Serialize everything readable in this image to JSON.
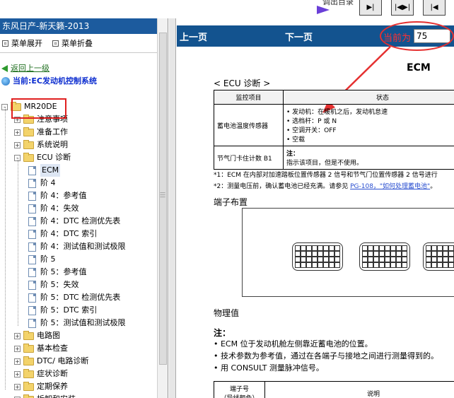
{
  "left_panel": {
    "title": "东风日产-新天籁-2013",
    "expand_label": "菜单展开",
    "collapse_label": "菜单折叠",
    "back_link": "返回上一级",
    "current_link": "当前:EC发动机控制系统"
  },
  "tree": [
    {
      "label": "MR20DE",
      "kind": "folder",
      "level": 0,
      "toggle": "-"
    },
    {
      "label": "注意事项",
      "kind": "folder",
      "level": 1,
      "toggle": "+"
    },
    {
      "label": "准备工作",
      "kind": "folder",
      "level": 1,
      "toggle": "+"
    },
    {
      "label": "系统说明",
      "kind": "folder",
      "level": 1,
      "toggle": "+"
    },
    {
      "label": "ECU 诊断",
      "kind": "folder",
      "level": 1,
      "toggle": "-"
    },
    {
      "label": "ECM",
      "kind": "doc",
      "level": 2,
      "selected": true
    },
    {
      "label": "阶 4",
      "kind": "doc",
      "level": 2
    },
    {
      "label": "阶 4：参考值",
      "kind": "doc",
      "level": 2
    },
    {
      "label": "阶 4：失效",
      "kind": "doc",
      "level": 2
    },
    {
      "label": "阶 4：DTC 检测优先表",
      "kind": "doc",
      "level": 2
    },
    {
      "label": "阶 4：DTC 索引",
      "kind": "doc",
      "level": 2
    },
    {
      "label": "阶 4：测试值和测试极限",
      "kind": "doc",
      "level": 2
    },
    {
      "label": "阶 5",
      "kind": "doc",
      "level": 2
    },
    {
      "label": "阶 5：参考值",
      "kind": "doc",
      "level": 2
    },
    {
      "label": "阶 5：失效",
      "kind": "doc",
      "level": 2
    },
    {
      "label": "阶 5：DTC 检测优先表",
      "kind": "doc",
      "level": 2
    },
    {
      "label": "阶 5：DTC 索引",
      "kind": "doc",
      "level": 2
    },
    {
      "label": "阶 5：测试值和测试极限",
      "kind": "doc",
      "level": 2
    },
    {
      "label": "电路图",
      "kind": "folder",
      "level": 1,
      "toggle": "+"
    },
    {
      "label": "基本检查",
      "kind": "folder",
      "level": 1,
      "toggle": "+"
    },
    {
      "label": "DTC/ 电路诊断",
      "kind": "folder",
      "level": 1,
      "toggle": "+"
    },
    {
      "label": "症状诊断",
      "kind": "folder",
      "level": 1,
      "toggle": "+"
    },
    {
      "label": "定期保养",
      "kind": "folder",
      "level": 1,
      "toggle": "+"
    },
    {
      "label": "拆卸和安装",
      "kind": "folder",
      "level": 1,
      "toggle": "+"
    }
  ],
  "toolbar": {
    "caption": "调出目录",
    "buttons": [
      "▶|",
      "|◀▶|",
      "|◀"
    ]
  },
  "nav": {
    "prev": "上一页",
    "next": "下一页",
    "current_label": "当前为",
    "page_value": "75"
  },
  "doc": {
    "title": "ECM",
    "section_diag": "< ECU 诊断 >",
    "table_header": [
      "监控项目",
      "状态"
    ],
    "table_rows": [
      {
        "item": "蓄电池温度传感器",
        "status": [
          "• 发动机：在暖机之后，发动机怠速",
          "• 选档杆：P 或 N",
          "• 空调开关：OFF",
          "• 空载"
        ]
      },
      {
        "item": "节气门卡住计数 B1",
        "status": [
          "注：",
          "指示该项目，但是不使用。"
        ]
      }
    ],
    "note1": "*1：ECM 在内部对加速踏板位置传感器 2 信号和节气门位置传感器 2 信号进行",
    "note2_pre": "*2：测量电压前，确认蓄电池已经充满。请参见 ",
    "note2_link": "PG-108，\"如何处理蓄电池\"",
    "note2_post": "。",
    "section_terminal": "端子布置",
    "section_physical": "物理值",
    "note_title": "注：",
    "bullets": [
      "• ECM 位于发动机舱左侧靠近蓄电池的位置。",
      "• 技术参数为参考值，通过在各端子与接地之间进行测量得到的。",
      "• 用 CONSULT 测量脉冲信号。"
    ],
    "bottom_header": [
      "端子号\n（导线颜色）",
      "说明"
    ]
  },
  "colors": {
    "title_bar": "#1c5b9e",
    "nav_bar": "#13538f",
    "annotation_red": "#e53030",
    "link_blue": "#0b2ccf",
    "back_green": "#1f6f1f"
  }
}
